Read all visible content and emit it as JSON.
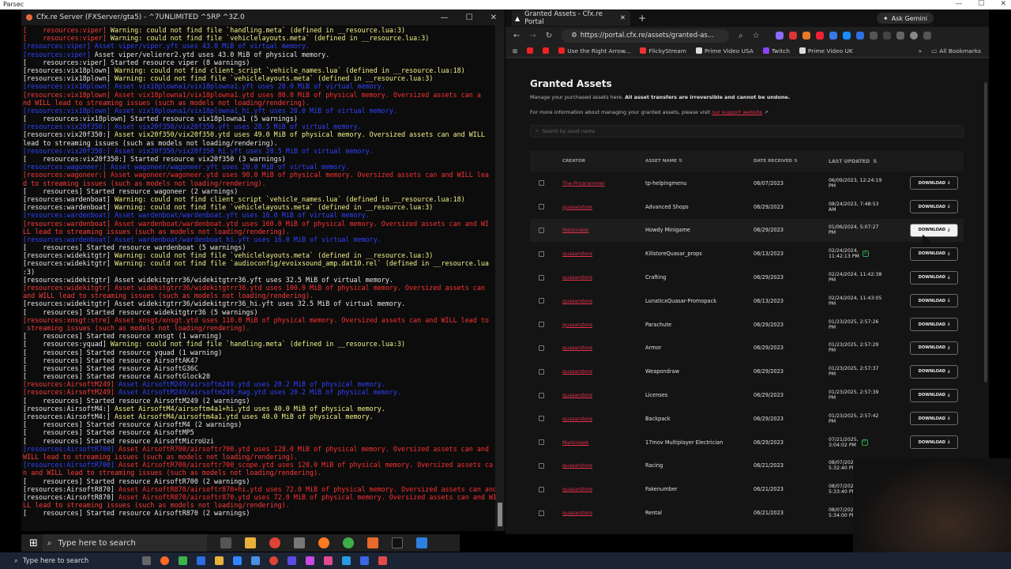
{
  "outer": {
    "title": "Parsec"
  },
  "console": {
    "title": "Cfx.re Server (FXServer/gta5) - ^7UNLIMITED ^5RP ^3Z.0",
    "lines": [
      {
        "p": "[    resources:viper]",
        "pc": "pre-r",
        "m": " Warning: could not find file `handling.meta` (defined in __resource.lua:3)",
        "mc": "msg-y"
      },
      {
        "p": "[    resources:viper]",
        "pc": "pre-r",
        "m": " Warning: could not find file `vehiclelayouts.meta` (defined in __resource.lua:3)",
        "mc": "msg-y"
      },
      {
        "p": "[resources:viper]",
        "pc": "pre-b",
        "m": " Asset viper/viper.yft uses 43.0 MiB of virtual memory.",
        "mc": "msg-b"
      },
      {
        "p": "[resources:viper]",
        "pc": "pre-b",
        "m": " Asset viper/velierer2.ytd uses 43.0 MiB of physical memory.",
        "mc": "msg-w"
      },
      {
        "p": "[    resources:viper]",
        "pc": "pre-w",
        "m": " Started resource viper (8 warnings)",
        "mc": "msg-w"
      },
      {
        "p": "[resources:vix18plown]",
        "pc": "pre-w",
        "m": " Warning: could not find client_script `vehicle_names.lua` (defined in __resource.lua:18)",
        "mc": "msg-y"
      },
      {
        "p": "[resources:vix18plown]",
        "pc": "pre-w",
        "m": " Warning: could not find file `vehiclelayouts.meta` (defined in __resource.lua:3)",
        "mc": "msg-y"
      },
      {
        "p": "[resources:vix18plown]",
        "pc": "pre-b",
        "m": " Asset vix18plowna1/vix18plowna1.yft uses 20.0 MiB of virtual memory.",
        "mc": "msg-b"
      },
      {
        "p": "[resources:vix18plown]",
        "pc": "pre-r",
        "m": " Asset vix18plowna1/vix18plowna1.ytd uses 80.0 MiB of physical memory. Oversized assets can a",
        "mc": "msg-r"
      },
      {
        "p": "nd WILL lead to streaming issues (such as models not loading/rendering).",
        "pc": "pre-r",
        "m": "",
        "mc": "msg-r"
      },
      {
        "p": "[resources:vix18plown]",
        "pc": "pre-b",
        "m": " Asset vix18plowna1/vix18plowna1_hi.yft uses 20.0 MiB of virtual memory.",
        "mc": "msg-b"
      },
      {
        "p": "[    resources:vix18plown]",
        "pc": "pre-w",
        "m": " Started resource vix18plowna1 (5 warnings)",
        "mc": "msg-w"
      },
      {
        "p": "[resources:vix20f350:]",
        "pc": "pre-b",
        "m": " Asset vix20f350/vix20f350.yft uses 28.5 MiB of virtual memory.",
        "mc": "msg-b"
      },
      {
        "p": "[resources:vix20f350:]",
        "pc": "pre-w",
        "m": " Asset vix20f350/vix20f350.ytd uses 49.0 MiB of physical memory. Oversized assets can and WILL",
        "mc": "msg-y"
      },
      {
        "p": "lead to streaming issues (such as models not loading/rendering).",
        "pc": "pre-w",
        "m": "",
        "mc": "msg-y"
      },
      {
        "p": "[resources:vix20f350:]",
        "pc": "pre-b",
        "m": " Asset vix20f350/vix20f350_hi.yft uses 28.5 MiB of virtual memory.",
        "mc": "msg-b"
      },
      {
        "p": "[    resources:vix20f350:]",
        "pc": "pre-w",
        "m": " Started resource vix20f350 (3 warnings)",
        "mc": "msg-w"
      },
      {
        "p": "[resources:wagoneer:]",
        "pc": "pre-b",
        "m": " Asset wagoneer/wagoneer.yft uses 20.0 MiB of virtual memory.",
        "mc": "msg-b"
      },
      {
        "p": "[resources:wagoneer:]",
        "pc": "pre-r",
        "m": " Asset wagoneer/wagoneer.ytd uses 90.0 MiB of physical memory. Oversized assets can and WILL lea",
        "mc": "msg-r"
      },
      {
        "p": "d to streaming issues (such as models not loading/rendering).",
        "pc": "pre-r",
        "m": "",
        "mc": "msg-r"
      },
      {
        "p": "[    resources]",
        "pc": "pre-w",
        "m": " Started resource wagoneer (2 warnings)",
        "mc": "msg-w"
      },
      {
        "p": "[resources:wardenboat]",
        "pc": "pre-w",
        "m": " Warning: could not find client_script `vehicle_names.lua` (defined in __resource.lua:18)",
        "mc": "msg-y"
      },
      {
        "p": "[resources:wardenboat]",
        "pc": "pre-w",
        "m": " Warning: could not find file `vehiclelayouts.meta` (defined in __resource.lua:3)",
        "mc": "msg-y"
      },
      {
        "p": "[resources:wardenboat]",
        "pc": "pre-b",
        "m": " Asset wardenboat/wardenboat.yft uses 16.0 MiB of virtual memory.",
        "mc": "msg-b"
      },
      {
        "p": "[resources:wardenboat]",
        "pc": "pre-r",
        "m": " Asset wardenboat/wardenboat.ytd uses 160.0 MiB of physical memory. Oversized assets can and WI",
        "mc": "msg-r"
      },
      {
        "p": "LL lead to streaming issues (such as models not loading/rendering).",
        "pc": "pre-r",
        "m": "",
        "mc": "msg-r"
      },
      {
        "p": "[resources:wardenboat]",
        "pc": "pre-b",
        "m": " Asset wardenboat/wardenboat_hi.yft uses 16.0 MiB of virtual memory.",
        "mc": "msg-b"
      },
      {
        "p": "[    resources]",
        "pc": "pre-w",
        "m": " Started resource wardenboat (5 warnings)",
        "mc": "msg-w"
      },
      {
        "p": "[resources:widekitgtr]",
        "pc": "pre-w",
        "m": " Warning: could not find file `vehiclelayouts.meta` (defined in __resource.lua:3)",
        "mc": "msg-y"
      },
      {
        "p": "[resources:widekitgtr]",
        "pc": "pre-w",
        "m": " Warning: could not find file `audioconfig/evoixsound_amp.dat10.rel` (defined in __resource.lua",
        "mc": "msg-y"
      },
      {
        "p": ":3)",
        "pc": "pre-w",
        "m": "",
        "mc": "msg-y"
      },
      {
        "p": "[resources:widekitgtr]",
        "pc": "pre-w",
        "m": " Asset widekitgtrr36/widekitgtrr36.yft uses 32.5 MiB of virtual memory.",
        "mc": "msg-w"
      },
      {
        "p": "[resources:widekitgtr]",
        "pc": "pre-r",
        "m": " Asset widekitgtrr36/widekitgtrr36.ytd uses 100.0 MiB of physical memory. Oversized assets can",
        "mc": "msg-r"
      },
      {
        "p": "and WILL lead to streaming issues (such as models not loading/rendering).",
        "pc": "pre-r",
        "m": "",
        "mc": "msg-r"
      },
      {
        "p": "[resources:widekitgtr]",
        "pc": "pre-w",
        "m": " Asset widekitgtrr36/widekitgtrr36_hi.yft uses 32.5 MiB of virtual memory.",
        "mc": "msg-w"
      },
      {
        "p": "[    resources]",
        "pc": "pre-w",
        "m": " Started resource widekitgtrr36 (5 warnings)",
        "mc": "msg-w"
      },
      {
        "p": "[resources:xnsgt:stre]",
        "pc": "pre-r",
        "m": " Asset xnsgt/xnsgt.ytd uses 110.0 MiB of physical memory. Oversized assets can and WILL lead to",
        "mc": "msg-r"
      },
      {
        "p": " streaming issues (such as models not loading/rendering).",
        "pc": "pre-r",
        "m": "",
        "mc": "msg-r"
      },
      {
        "p": "[    resources]",
        "pc": "pre-w",
        "m": " Started resource xnsgt (1 warning)",
        "mc": "msg-w"
      },
      {
        "p": "[    resources:yquad]",
        "pc": "pre-w",
        "m": " Warning: could not find file `handling.meta` (defined in __resource.lua:3)",
        "mc": "msg-y"
      },
      {
        "p": "[    resources]",
        "pc": "pre-w",
        "m": " Started resource yquad (1 warning)",
        "mc": "msg-w"
      },
      {
        "p": "[    resources]",
        "pc": "pre-w",
        "m": " Started resource AirsoftAK47",
        "mc": "msg-w"
      },
      {
        "p": "[    resources]",
        "pc": "pre-w",
        "m": " Started resource AirsoftG36C",
        "mc": "msg-w"
      },
      {
        "p": "[    resources]",
        "pc": "pre-w",
        "m": " Started resource AirsoftGlock20",
        "mc": "msg-w"
      },
      {
        "p": "[resources:AirsoftM249]",
        "pc": "pre-r",
        "m": " Asset AirsoftM249/airsoftm249.ytd uses 20.2 MiB of physical memory.",
        "mc": "msg-b"
      },
      {
        "p": "[resources:AirsoftM249]",
        "pc": "pre-r",
        "m": " Asset AirsoftM249/airsoftm249_mag.ytd uses 20.2 MiB of physical memory.",
        "mc": "msg-b"
      },
      {
        "p": "[    resources]",
        "pc": "pre-w",
        "m": " Started resource AirsoftM249 (2 warnings)",
        "mc": "msg-w"
      },
      {
        "p": "[resources:AirsoftM4:]",
        "pc": "pre-w",
        "m": " Asset AirsoftM4/airsoftm4a1+hi.ytd uses 40.0 MiB of physical memory.",
        "mc": "msg-y"
      },
      {
        "p": "[resources:AirsoftM4:]",
        "pc": "pre-w",
        "m": " Asset AirsoftM4/airsoftm4a1.ytd uses 40.0 MiB of physical memory.",
        "mc": "msg-y"
      },
      {
        "p": "[    resources]",
        "pc": "pre-w",
        "m": " Started resource AirsoftM4 (2 warnings)",
        "mc": "msg-w"
      },
      {
        "p": "[    resources]",
        "pc": "pre-w",
        "m": " Started resource AirsoftMP5",
        "mc": "msg-w"
      },
      {
        "p": "[    resources]",
        "pc": "pre-w",
        "m": " Started resource AirsoftMicroUzi",
        "mc": "msg-w"
      },
      {
        "p": "[resources:AirsoftR700]",
        "pc": "pre-b",
        "m": " Asset AirsoftR700/airsoftr700.ytd uses 128.0 MiB of physical memory. Oversized assets can and",
        "mc": "msg-r"
      },
      {
        "p": "WILL lead to streaming issues (such as models not loading/rendering).",
        "pc": "pre-r",
        "m": "",
        "mc": "msg-r"
      },
      {
        "p": "[resources:AirsoftR700]",
        "pc": "pre-b",
        "m": " Asset AirsoftR700/airsoftr700_scope.ytd uses 128.0 MiB of physical memory. Oversized assets ca",
        "mc": "msg-r"
      },
      {
        "p": "n and WILL lead to streaming issues (such as models not loading/rendering).",
        "pc": "pre-r",
        "m": "",
        "mc": "msg-r"
      },
      {
        "p": "[    resources]",
        "pc": "pre-w",
        "m": " Started resource AirsoftR700 (2 warnings)",
        "mc": "msg-w"
      },
      {
        "p": "[resources:AirsoftR870]",
        "pc": "pre-w",
        "m": " Asset AirsoftR870/airsoftr870+hi.ytd uses 72.0 MiB of physical memory. Oversized assets can and",
        "mc": "msg-r"
      },
      {
        "p": "[resources:AirsoftR870]",
        "pc": "pre-w",
        "m": " Asset AirsoftR870/airsoftr870.ytd uses 72.0 MiB of physical memory. Oversized assets can and WI",
        "mc": "msg-r"
      },
      {
        "p": "LL lead to streaming issues (such as models not loading/rendering).",
        "pc": "pre-r",
        "m": "",
        "mc": "msg-r"
      },
      {
        "p": "[    resources]",
        "pc": "pre-w",
        "m": " Started resource AirsoftR870 (2 warnings)",
        "mc": "msg-w"
      }
    ]
  },
  "browser": {
    "tab_title": "Granted Assets - Cfx.re Portal",
    "ask_gemini": "Ask Gemini",
    "url": "https://portal.cfx.re/assets/granted-as...",
    "bookmarks": [
      "Use the Right Arrow...",
      "FlickyStream",
      "Prime Video USA",
      "Twitch",
      "Prime Video UK"
    ],
    "all_bookmarks": "All Bookmarks"
  },
  "page": {
    "title": "Granted Assets",
    "desc_pre": "Manage your purchased assets here. ",
    "desc_bold": "All asset transfers are irreversible and cannot be undone.",
    "info_pre": "For more information about managing your granted assets, please visit ",
    "info_link": "our support website",
    "search_placeholder": "Search by asset name",
    "columns": {
      "creator": "CREATOR",
      "asset_name": "ASSET NAME",
      "date_received": "DATE RECEIVED",
      "last_updated": "LAST UPDATED"
    },
    "download_label": "DOWNLOAD",
    "rows": [
      {
        "creator": "The-Programmer",
        "name": "tp-helpingmenu",
        "date": "06/07/2023",
        "upd1": "06/09/2023, 12:24:19",
        "upd2": "PM",
        "badge": false
      },
      {
        "creator": "quasarstore",
        "name": "Advanced Shops",
        "date": "06/29/2023",
        "upd1": "08/24/2023, 7:48:53",
        "upd2": "AM",
        "badge": false
      },
      {
        "creator": "Malizniakk",
        "name": "Howdy Minigame",
        "date": "06/29/2023",
        "upd1": "01/06/2024, 5:07:27",
        "upd2": "PM",
        "badge": false
      },
      {
        "creator": "quasarstore",
        "name": "KillstoreQuasar_props",
        "date": "06/13/2023",
        "upd1": "02/24/2024,",
        "upd2": "11:42:13 PM",
        "badge": true
      },
      {
        "creator": "quasarstore",
        "name": "Crafting",
        "date": "06/29/2023",
        "upd1": "02/24/2024, 11:42:38",
        "upd2": "PM",
        "badge": false
      },
      {
        "creator": "quasarstore",
        "name": "LunaticxQuasar-Promopack",
        "date": "06/13/2023",
        "upd1": "02/24/2024, 11:43:05",
        "upd2": "PM",
        "badge": false
      },
      {
        "creator": "quasarstore",
        "name": "Parachute",
        "date": "06/29/2023",
        "upd1": "01/23/2025, 2:57:26",
        "upd2": "PM",
        "badge": false
      },
      {
        "creator": "quasarstore",
        "name": "Armor",
        "date": "06/29/2023",
        "upd1": "01/23/2025, 2:57:29",
        "upd2": "PM",
        "badge": false
      },
      {
        "creator": "quasarstore",
        "name": "Weapondraw",
        "date": "06/29/2023",
        "upd1": "01/23/2025, 2:57:37",
        "upd2": "PM",
        "badge": false
      },
      {
        "creator": "quasarstore",
        "name": "Licenses",
        "date": "06/29/2023",
        "upd1": "01/23/2025, 2:57:39",
        "upd2": "PM",
        "badge": false
      },
      {
        "creator": "quasarstore",
        "name": "Backpack",
        "date": "06/29/2023",
        "upd1": "01/23/2025, 2:57:42",
        "upd2": "PM",
        "badge": false
      },
      {
        "creator": "Malizniakk",
        "name": "17mov Multiplayer Electrician",
        "date": "06/29/2023",
        "upd1": "07/21/2025,",
        "upd2": "3:04:02 PM",
        "badge": true
      },
      {
        "creator": "quasarstore",
        "name": "Racing",
        "date": "06/21/2023",
        "upd1": "08/07/2025,",
        "upd2": "5:32:40 PM",
        "badge": true
      },
      {
        "creator": "quasarstore",
        "name": "Fakenumber",
        "date": "06/21/2023",
        "upd1": "08/07/2025,",
        "upd2": "5:33:40 PM",
        "badge": false
      },
      {
        "creator": "quasarstore",
        "name": "Rental",
        "date": "06/21/2023",
        "upd1": "08/07/2025,",
        "upd2": "5:34:00 PM",
        "badge": false
      }
    ]
  },
  "taskbar": {
    "search_placeholder": "Type here to search",
    "search_placeholder2": "Type here to search"
  },
  "colors": {
    "accent_link": "#e6314b",
    "console_bg": "#0c0c0c",
    "page_bg": "#141414"
  }
}
